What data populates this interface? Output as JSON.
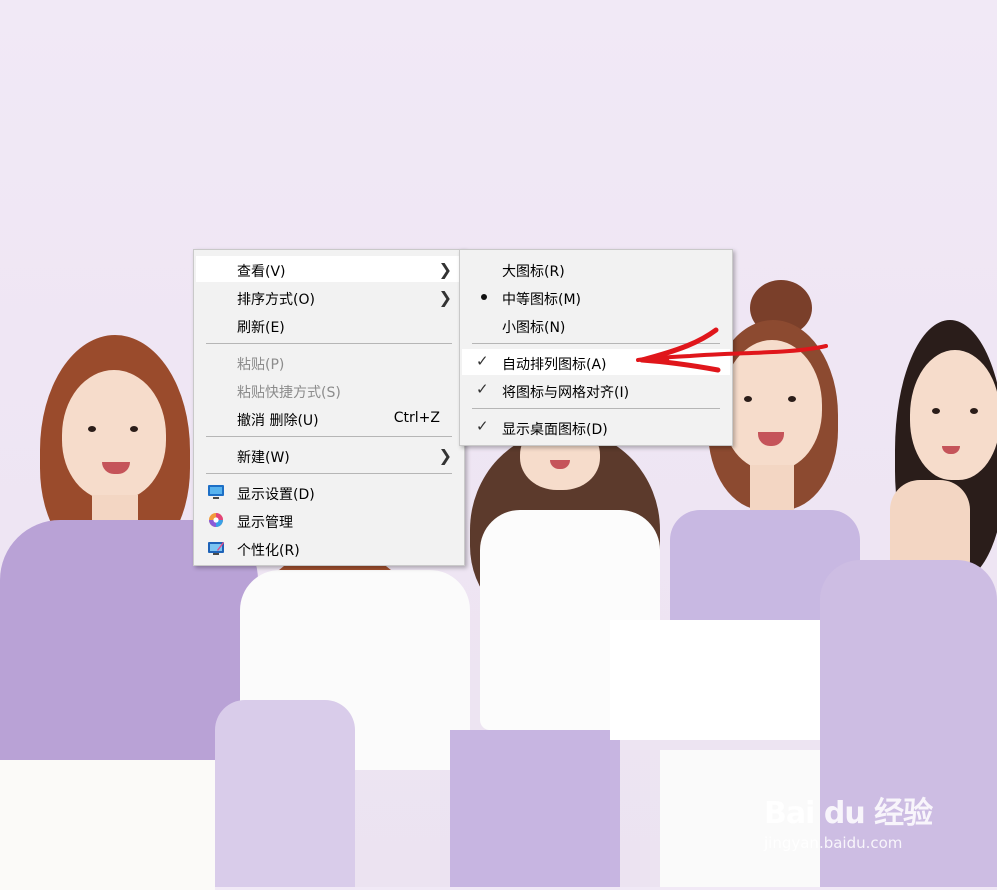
{
  "context_menu": {
    "items": [
      {
        "label": "查看(V)",
        "has_submenu": true,
        "highlighted": true
      },
      {
        "label": "排序方式(O)",
        "has_submenu": true
      },
      {
        "label": "刷新(E)"
      },
      {
        "label": "粘贴(P)",
        "disabled": true
      },
      {
        "label": "粘贴快捷方式(S)",
        "disabled": true
      },
      {
        "label": "撤消 删除(U)",
        "shortcut": "Ctrl+Z"
      },
      {
        "label": "新建(W)",
        "has_submenu": true
      },
      {
        "label": "显示设置(D)",
        "icon": "display-settings-icon"
      },
      {
        "label": "显示管理",
        "icon": "display-manager-icon"
      },
      {
        "label": "个性化(R)",
        "icon": "personalize-icon"
      }
    ]
  },
  "view_submenu": {
    "items": [
      {
        "label": "大图标(R)"
      },
      {
        "label": "中等图标(M)",
        "selected": true
      },
      {
        "label": "小图标(N)"
      },
      {
        "label": "自动排列图标(A)",
        "checked": true,
        "highlighted": true
      },
      {
        "label": "将图标与网格对齐(I)",
        "checked": true
      },
      {
        "label": "显示桌面图标(D)",
        "checked": true
      }
    ]
  },
  "watermark": {
    "logo_text": "Bai du 经验",
    "url": "jingyan.baidu.com"
  },
  "colors": {
    "menu_background": "#f2f2f2",
    "menu_hover": "#ffffff",
    "annotation_arrow": "#e0161b",
    "wallpaper": "#efe6f4"
  }
}
